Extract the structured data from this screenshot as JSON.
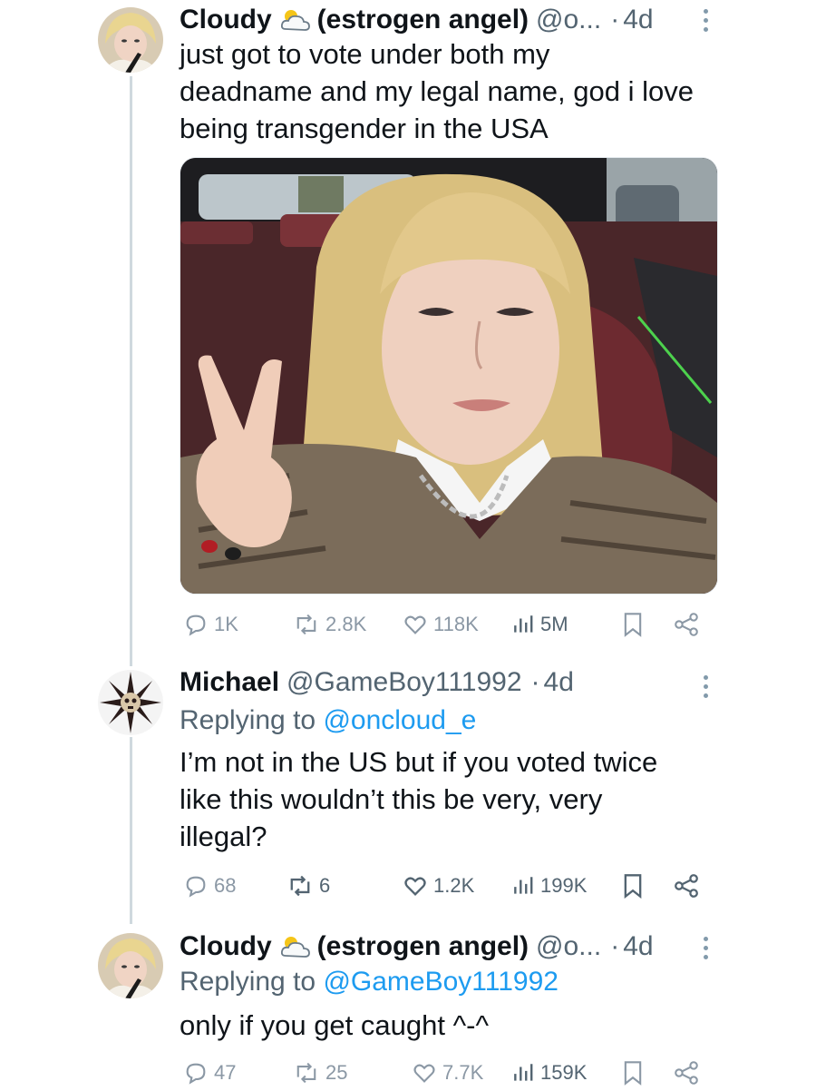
{
  "tweets": [
    {
      "display_name": "Cloudy",
      "display_name_suffix": "(estrogen angel)",
      "handle": "@o...",
      "dot": "·",
      "time": "4d",
      "text": "just got to vote under both my\ndeadname and my legal name, god i love\nbeing transgender in the USA",
      "stats": {
        "replies": "1K",
        "reposts": "2.8K",
        "likes": "118K",
        "views": "5M"
      }
    },
    {
      "display_name": "Michael",
      "handle": "@GameBoy111992",
      "dot": "·",
      "time": "4d",
      "replying_prefix": "Replying to",
      "replying_to": "@oncloud_e",
      "text": "I’m not in the US but if you voted twice\nlike this wouldn’t this be very, very\nillegal?",
      "stats": {
        "replies": "68",
        "reposts": "6",
        "likes": "1.2K",
        "views": "199K"
      }
    },
    {
      "display_name": "Cloudy",
      "display_name_suffix": "(estrogen angel)",
      "handle": "@o...",
      "dot": "·",
      "time": "4d",
      "replying_prefix": "Replying to",
      "replying_to": "@GameBoy111992",
      "text": "only if you get caught ^-^",
      "stats": {
        "replies": "47",
        "reposts": "25",
        "likes": "7.7K",
        "views": "159K"
      }
    }
  ],
  "colors": {
    "text": "#0f1419",
    "muted": "#536471",
    "link": "#1d9bf0",
    "thread_line": "#cfd9de"
  }
}
